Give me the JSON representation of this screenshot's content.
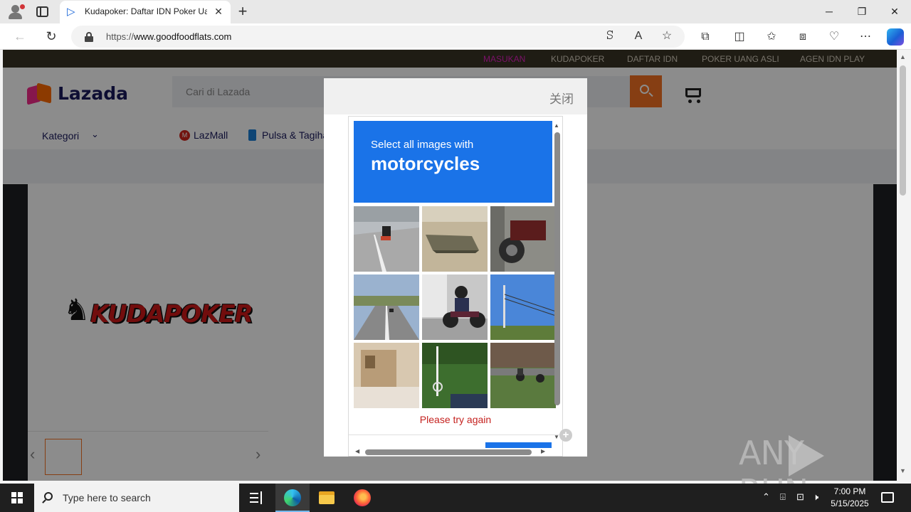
{
  "browser": {
    "tab_title": "Kudapoker: Daftar IDN Poker Uang Asli",
    "url_prefix": "https://",
    "url_domain": "www.goodfoodflats.com"
  },
  "site": {
    "topnav": [
      "MASUKAN",
      "KUDAPOKER",
      "DAFTAR IDN",
      "POKER UANG ASLI",
      "AGEN IDN PLAY"
    ],
    "logo": "Lazada",
    "search_placeholder": "Cari di Lazada",
    "kategori": "Kategori",
    "lazmall": "LazMall",
    "pulsa": "Pulsa & Tagihan",
    "brand_logo": "KUDAPOKER"
  },
  "modal": {
    "close_label": "关闭",
    "captcha": {
      "prompt": "Select all images with",
      "target": "motorcycles",
      "error": "Please try again"
    }
  },
  "watermark": "ANY RUN",
  "taskbar": {
    "search_placeholder": "Type here to search",
    "time": "7:00 PM",
    "date": "5/15/2025"
  },
  "colors": {
    "lazada_orange": "#f57224",
    "captcha_blue": "#1a73e8",
    "error_red": "#c5221f",
    "topnav_active": "#e020c0"
  }
}
